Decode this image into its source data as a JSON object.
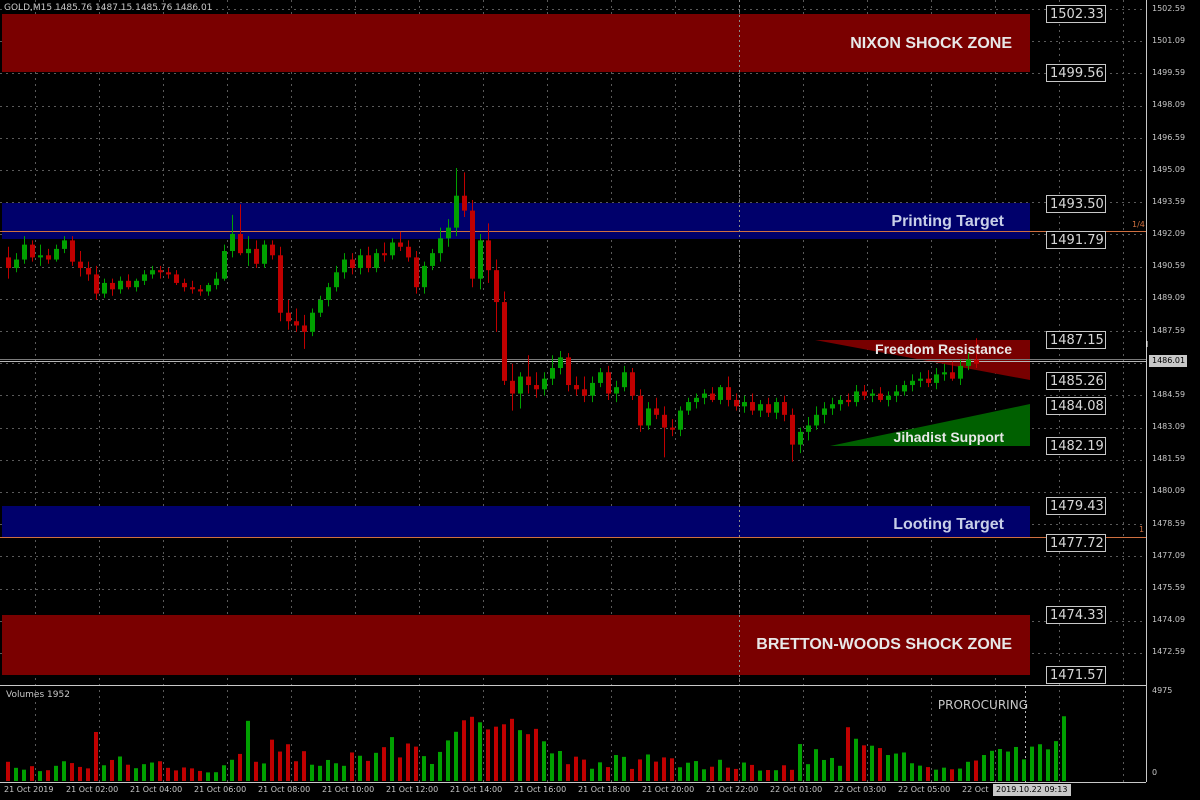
{
  "header": {
    "symbol_info": "GOLD,M15  1485.76 1487.15 1485.76 1486.01"
  },
  "zones": {
    "nixon": "NIXON SHOCK ZONE",
    "printing": "Printing Target",
    "freedom": "Freedom Resistance",
    "jihadist": "Jihadist Support",
    "looting": "Looting Target",
    "bretton": "BRETTON-WOODS SHOCK ZONE"
  },
  "price_tags": [
    "1502.33",
    "1499.56",
    "1493.50",
    "1491.79",
    "1487.15",
    "1485.26",
    "1484.08",
    "1482.19",
    "1479.43",
    "1477.72",
    "1474.33",
    "1471.57"
  ],
  "fib_labels": {
    "quarter": "1/4",
    "one": "1"
  },
  "current_price": "1486.01",
  "price_axis": [
    "1502.59",
    "1501.09",
    "1499.59",
    "1498.09",
    "1496.59",
    "1495.09",
    "1493.59",
    "1492.09",
    "1490.59",
    "1489.09",
    "1487.59",
    "1484.59",
    "1483.09",
    "1481.59",
    "1480.09",
    "1478.59",
    "1477.09",
    "1475.59",
    "1474.09",
    "1472.59"
  ],
  "volume_panel": {
    "title": "Volumes 1952",
    "max_label": "4975",
    "zero_label": "0",
    "watermark": "PROROCURING"
  },
  "time_axis": [
    "21 Oct 2019",
    "21 Oct 02:00",
    "21 Oct 04:00",
    "21 Oct 06:00",
    "21 Oct 08:00",
    "21 Oct 10:00",
    "21 Oct 12:00",
    "21 Oct 14:00",
    "21 Oct 16:00",
    "21 Oct 18:00",
    "21 Oct 20:00",
    "21 Oct 22:00",
    "22 Oct 01:00",
    "22 Oct 03:00",
    "22 Oct 05:00",
    "22 Oct"
  ],
  "time_cursor": "2019.10.22 09:13",
  "chart_data": {
    "type": "candlestick",
    "symbol": "GOLD",
    "timeframe": "M15",
    "y_range": [
      1470.9,
      1503.1
    ],
    "colors": {
      "bull": "#00a000",
      "bear": "#c00000",
      "grid": "#5a5a5a"
    },
    "candles": [
      [
        1491.0,
        1491.5,
        1490.0,
        1490.5
      ],
      [
        1490.5,
        1491.2,
        1490.3,
        1490.9
      ],
      [
        1490.9,
        1492.0,
        1490.7,
        1491.6
      ],
      [
        1491.6,
        1491.8,
        1490.8,
        1491.0
      ],
      [
        1491.0,
        1491.6,
        1490.6,
        1491.1
      ],
      [
        1491.1,
        1491.4,
        1490.7,
        1490.9
      ],
      [
        1490.9,
        1491.6,
        1490.8,
        1491.4
      ],
      [
        1491.4,
        1492.0,
        1491.2,
        1491.8
      ],
      [
        1491.8,
        1492.0,
        1490.6,
        1490.8
      ],
      [
        1490.8,
        1491.3,
        1490.1,
        1490.5
      ],
      [
        1490.5,
        1490.8,
        1489.9,
        1490.2
      ],
      [
        1490.2,
        1490.6,
        1489.0,
        1489.3
      ],
      [
        1489.3,
        1490.0,
        1489.1,
        1489.8
      ],
      [
        1489.8,
        1490.0,
        1489.2,
        1489.5
      ],
      [
        1489.5,
        1490.1,
        1489.3,
        1489.9
      ],
      [
        1489.9,
        1490.2,
        1489.5,
        1489.6
      ],
      [
        1489.6,
        1490.0,
        1489.4,
        1489.9
      ],
      [
        1489.9,
        1490.4,
        1489.7,
        1490.2
      ],
      [
        1490.2,
        1490.6,
        1490.0,
        1490.4
      ],
      [
        1490.4,
        1490.6,
        1490.0,
        1490.3
      ],
      [
        1490.3,
        1490.5,
        1490.0,
        1490.2
      ],
      [
        1490.2,
        1490.4,
        1489.7,
        1489.8
      ],
      [
        1489.8,
        1490.0,
        1489.4,
        1489.6
      ],
      [
        1489.6,
        1489.9,
        1489.3,
        1489.5
      ],
      [
        1489.5,
        1489.7,
        1489.2,
        1489.4
      ],
      [
        1489.4,
        1489.8,
        1489.2,
        1489.7
      ],
      [
        1489.7,
        1490.3,
        1489.5,
        1490.0
      ],
      [
        1490.0,
        1491.6,
        1489.9,
        1491.3
      ],
      [
        1491.3,
        1493.0,
        1491.0,
        1492.1
      ],
      [
        1492.1,
        1493.5,
        1491.1,
        1491.2
      ],
      [
        1491.2,
        1492.0,
        1490.6,
        1491.4
      ],
      [
        1491.4,
        1491.8,
        1490.5,
        1490.7
      ],
      [
        1490.7,
        1491.8,
        1490.5,
        1491.6
      ],
      [
        1491.6,
        1491.8,
        1490.9,
        1491.1
      ],
      [
        1491.1,
        1491.5,
        1488.0,
        1488.4
      ],
      [
        1488.4,
        1489.0,
        1487.6,
        1488.0
      ],
      [
        1488.0,
        1488.6,
        1487.5,
        1487.8
      ],
      [
        1487.8,
        1488.3,
        1486.7,
        1487.5
      ],
      [
        1487.5,
        1488.6,
        1487.3,
        1488.4
      ],
      [
        1488.4,
        1489.2,
        1488.2,
        1489.0
      ],
      [
        1489.0,
        1489.8,
        1488.7,
        1489.6
      ],
      [
        1489.6,
        1490.6,
        1489.4,
        1490.3
      ],
      [
        1490.3,
        1491.2,
        1490.0,
        1490.9
      ],
      [
        1490.9,
        1491.2,
        1490.2,
        1490.5
      ],
      [
        1490.5,
        1491.4,
        1490.2,
        1491.1
      ],
      [
        1491.1,
        1491.5,
        1490.3,
        1490.5
      ],
      [
        1490.5,
        1491.4,
        1490.3,
        1491.2
      ],
      [
        1491.2,
        1491.7,
        1490.8,
        1491.1
      ],
      [
        1491.1,
        1491.9,
        1490.9,
        1491.7
      ],
      [
        1491.7,
        1492.2,
        1491.3,
        1491.5
      ],
      [
        1491.5,
        1491.8,
        1490.8,
        1491.0
      ],
      [
        1491.0,
        1491.3,
        1489.3,
        1489.6
      ],
      [
        1489.6,
        1490.8,
        1489.3,
        1490.6
      ],
      [
        1490.6,
        1491.4,
        1490.4,
        1491.2
      ],
      [
        1491.2,
        1492.4,
        1490.8,
        1491.9
      ],
      [
        1491.9,
        1492.8,
        1491.5,
        1492.4
      ],
      [
        1492.4,
        1495.2,
        1492.0,
        1493.9
      ],
      [
        1493.9,
        1495.0,
        1492.9,
        1493.2
      ],
      [
        1493.2,
        1493.7,
        1489.6,
        1490.0
      ],
      [
        1490.0,
        1492.1,
        1489.5,
        1491.8
      ],
      [
        1491.8,
        1492.6,
        1489.8,
        1490.4
      ],
      [
        1490.4,
        1490.9,
        1487.5,
        1488.9
      ],
      [
        1488.9,
        1489.4,
        1485.0,
        1485.2
      ],
      [
        1485.2,
        1486.0,
        1483.8,
        1484.6
      ],
      [
        1484.6,
        1485.6,
        1483.9,
        1485.4
      ],
      [
        1485.4,
        1486.4,
        1484.6,
        1485.0
      ],
      [
        1485.0,
        1485.6,
        1484.4,
        1484.8
      ],
      [
        1484.8,
        1485.6,
        1484.5,
        1485.3
      ],
      [
        1485.3,
        1486.4,
        1485.0,
        1485.8
      ],
      [
        1485.8,
        1486.6,
        1485.5,
        1486.3
      ],
      [
        1486.3,
        1486.5,
        1484.7,
        1485.0
      ],
      [
        1485.0,
        1485.4,
        1484.5,
        1484.8
      ],
      [
        1484.8,
        1485.4,
        1484.2,
        1484.5
      ],
      [
        1484.5,
        1485.4,
        1484.2,
        1485.1
      ],
      [
        1485.1,
        1485.8,
        1484.9,
        1485.6
      ],
      [
        1485.6,
        1485.9,
        1484.3,
        1484.6
      ],
      [
        1484.6,
        1485.2,
        1484.2,
        1484.9
      ],
      [
        1484.9,
        1485.9,
        1484.7,
        1485.6
      ],
      [
        1485.6,
        1485.8,
        1484.3,
        1484.5
      ],
      [
        1484.5,
        1484.8,
        1482.8,
        1483.1
      ],
      [
        1483.1,
        1484.2,
        1482.9,
        1483.9
      ],
      [
        1483.9,
        1484.4,
        1483.4,
        1483.6
      ],
      [
        1483.6,
        1484.0,
        1481.6,
        1483.0
      ],
      [
        1483.0,
        1483.4,
        1482.6,
        1482.9
      ],
      [
        1482.9,
        1484.0,
        1482.6,
        1483.8
      ],
      [
        1483.8,
        1484.4,
        1483.6,
        1484.2
      ],
      [
        1484.2,
        1484.6,
        1483.9,
        1484.4
      ],
      [
        1484.4,
        1484.8,
        1484.1,
        1484.6
      ],
      [
        1484.6,
        1484.9,
        1484.2,
        1484.3
      ],
      [
        1484.3,
        1485.0,
        1484.1,
        1484.9
      ],
      [
        1484.9,
        1485.4,
        1484.0,
        1484.3
      ],
      [
        1484.3,
        1484.6,
        1483.8,
        1484.0
      ],
      [
        1484.0,
        1484.5,
        1483.7,
        1484.2
      ],
      [
        1484.2,
        1484.6,
        1483.6,
        1483.8
      ],
      [
        1483.8,
        1484.3,
        1483.5,
        1484.1
      ],
      [
        1484.1,
        1484.4,
        1483.5,
        1483.7
      ],
      [
        1483.7,
        1484.4,
        1483.4,
        1484.2
      ],
      [
        1484.2,
        1484.5,
        1483.3,
        1483.6
      ],
      [
        1483.6,
        1483.9,
        1481.4,
        1482.2
      ],
      [
        1482.2,
        1483.0,
        1481.8,
        1482.8
      ],
      [
        1482.8,
        1483.5,
        1482.4,
        1483.1
      ],
      [
        1483.1,
        1484.0,
        1482.9,
        1483.6
      ],
      [
        1483.6,
        1484.2,
        1483.2,
        1483.9
      ],
      [
        1483.9,
        1484.4,
        1483.6,
        1484.1
      ],
      [
        1484.1,
        1484.5,
        1483.8,
        1484.3
      ],
      [
        1484.3,
        1484.6,
        1484.0,
        1484.2
      ],
      [
        1484.2,
        1485.0,
        1484.0,
        1484.7
      ],
      [
        1484.7,
        1485.0,
        1484.3,
        1484.5
      ],
      [
        1484.5,
        1484.8,
        1484.2,
        1484.6
      ],
      [
        1484.6,
        1484.9,
        1484.2,
        1484.3
      ],
      [
        1484.3,
        1484.7,
        1484.0,
        1484.5
      ],
      [
        1484.5,
        1485.0,
        1484.2,
        1484.7
      ],
      [
        1484.7,
        1485.2,
        1484.5,
        1485.0
      ],
      [
        1485.0,
        1485.5,
        1484.7,
        1485.2
      ],
      [
        1485.2,
        1485.6,
        1484.9,
        1485.3
      ],
      [
        1485.3,
        1485.7,
        1484.9,
        1485.1
      ],
      [
        1485.1,
        1485.8,
        1484.8,
        1485.5
      ],
      [
        1485.5,
        1486.0,
        1485.2,
        1485.6
      ],
      [
        1485.6,
        1486.1,
        1485.2,
        1485.3
      ],
      [
        1485.3,
        1486.2,
        1485.0,
        1485.9
      ],
      [
        1485.9,
        1486.5,
        1485.7,
        1486.2
      ],
      [
        1486.2,
        1487.2,
        1485.8,
        1486.0
      ]
    ],
    "volumes": [
      1050,
      720,
      620,
      810,
      540,
      590,
      830,
      1080,
      980,
      770,
      690,
      2680,
      860,
      1150,
      1340,
      890,
      700,
      920,
      1010,
      1080,
      720,
      580,
      740,
      690,
      550,
      470,
      480,
      860,
      1160,
      1480,
      3290,
      1050,
      960,
      2260,
      1610,
      2010,
      1080,
      1630,
      890,
      830,
      1150,
      970,
      830,
      1560,
      1380,
      1100,
      1540,
      1850,
      2400,
      1290,
      2050,
      1880,
      1360,
      930,
      1590,
      2220,
      2690,
      3320,
      3510,
      3210,
      2820,
      2970,
      3100,
      3400,
      2780,
      2560,
      2850,
      2170,
      1510,
      1640,
      920,
      1330,
      1170,
      670,
      1020,
      760,
      1420,
      1320,
      660,
      1180,
      1450,
      1060,
      1290,
      1240,
      750,
      1000,
      1090,
      640,
      780,
      1160,
      730,
      660,
      1010,
      880,
      570,
      600,
      590,
      860,
      610,
      2020,
      920,
      1740,
      1150,
      1260,
      830,
      2940,
      2310,
      1950,
      1930,
      1800,
      1420,
      1500,
      1560,
      970,
      840,
      760,
      620,
      730,
      640,
      680,
      1050,
      1120,
      1420,
      1650,
      1750,
      1610,
      1860,
      1180,
      1880,
      2010,
      1730,
      2180,
      3540
    ],
    "levels": {
      "nixon_zone": [
        1499.56,
        1502.33
      ],
      "printing_target": [
        1491.79,
        1493.5
      ],
      "freedom_resistance": [
        1485.26,
        1487.15
      ],
      "jihadist_support": [
        1482.19,
        1484.08
      ],
      "looting_target": [
        1477.72,
        1479.43
      ],
      "bretton_woods_zone": [
        1471.57,
        1474.33
      ]
    }
  }
}
